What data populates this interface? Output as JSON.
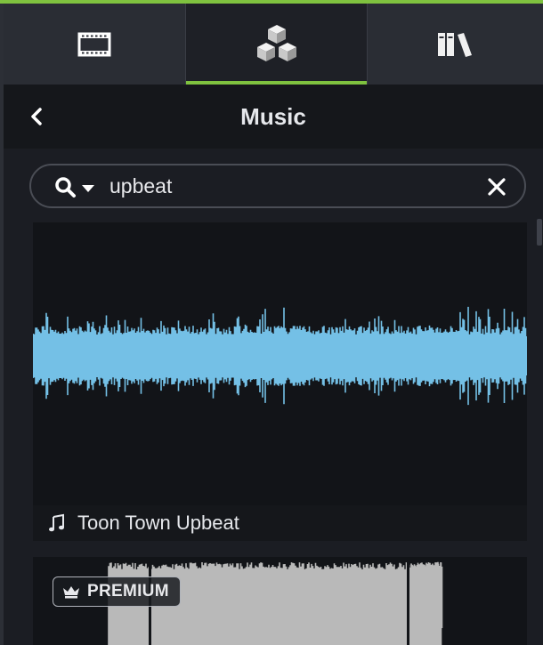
{
  "tabs": [
    {
      "name": "media-tab",
      "icon": "film-icon"
    },
    {
      "name": "library-tab",
      "icon": "cubes-icon",
      "active": true
    },
    {
      "name": "books-tab",
      "icon": "books-icon"
    }
  ],
  "header": {
    "title": "Music",
    "back_icon": "chevron-left-icon"
  },
  "search": {
    "value": "upbeat",
    "placeholder": "",
    "icon": "search-icon",
    "clear_icon": "close-icon"
  },
  "results": [
    {
      "title": "Toon Town Upbeat",
      "icon": "music-note-icon",
      "waveform_color": "#74c0e6"
    },
    {
      "badge": "PREMIUM",
      "badge_icon": "crown-icon",
      "waveform_color": "#b9b9b9"
    }
  ],
  "colors": {
    "accent": "#7fc23f",
    "background": "#1b1d23",
    "panel": "#2a2d34"
  }
}
